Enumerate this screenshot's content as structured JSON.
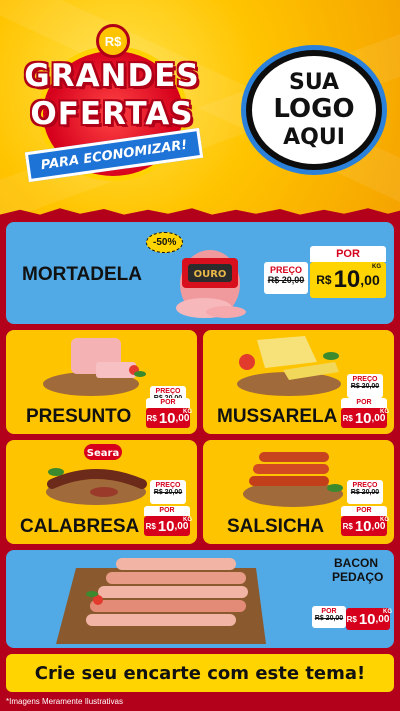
{
  "header": {
    "currency_badge": "R$",
    "title_line1": "GRANDES",
    "title_line2": "OFERTAS",
    "ribbon": "PARA ECONOMIZAR!",
    "logo_line1": "SUA",
    "logo_line2": "LOGO",
    "logo_line3": "AQUI"
  },
  "products": {
    "mortadela": {
      "name": "MORTADELA",
      "discount": "-50%",
      "brand": "OURO",
      "old_label": "PREÇO",
      "old_value": "R$ 20,00",
      "por": "POR",
      "currency": "R$",
      "price_int": "10",
      "price_dec": ",00",
      "unit": "KG"
    },
    "presunto": {
      "name": "PRESUNTO",
      "old_label": "PREÇO",
      "old_value": "R$ 20,00",
      "por": "POR",
      "currency": "R$",
      "price_int": "10",
      "price_dec": ",00",
      "unit": "KG"
    },
    "mussarela": {
      "name": "MUSSARELA",
      "old_label": "PREÇO",
      "old_value": "R$ 20,00",
      "por": "POR",
      "currency": "R$",
      "price_int": "10",
      "price_dec": ",00",
      "unit": "KG"
    },
    "calabresa": {
      "name": "CALABRESA",
      "brand": "Seara",
      "old_label": "PREÇO",
      "old_value": "R$ 20,00",
      "por": "POR",
      "currency": "R$",
      "price_int": "10",
      "price_dec": ",00",
      "unit": "KG"
    },
    "salsicha": {
      "name": "SALSICHA",
      "old_label": "PREÇO",
      "old_value": "R$ 20,00",
      "por": "POR",
      "currency": "R$",
      "price_int": "10",
      "price_dec": ",00",
      "unit": "KG"
    },
    "bacon": {
      "name_line1": "BACON",
      "name_line2": "PEDAÇO",
      "old_label": "POR",
      "old_value": "R$ 20,00",
      "currency": "R$",
      "price_int": "10",
      "price_dec": ",00",
      "unit": "KG"
    }
  },
  "footer": {
    "cta": "Crie seu encarte com este tema!",
    "note": "*Imagens Meramente Ilustrativas"
  },
  "colors": {
    "red": "#d6001c",
    "yellow": "#ffc400",
    "blue": "#51a9e6",
    "dark_red": "#b3001b"
  }
}
